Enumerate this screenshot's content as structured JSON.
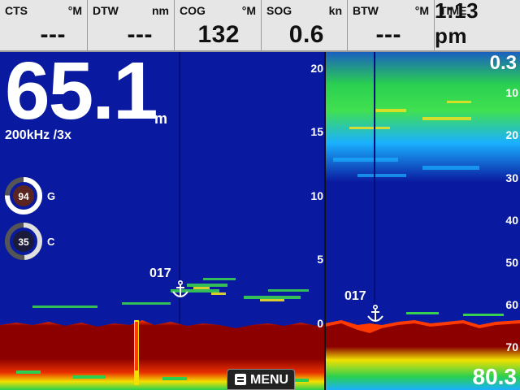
{
  "databar": {
    "fields": [
      {
        "label": "CTS",
        "unit": "°M",
        "value": "---"
      },
      {
        "label": "DTW",
        "unit": "nm",
        "value": "---"
      },
      {
        "label": "COG",
        "unit": "°M",
        "value": "132"
      },
      {
        "label": "SOG",
        "unit": "kn",
        "value": "0.6"
      },
      {
        "label": "BTW",
        "unit": "°M",
        "value": "---"
      },
      {
        "label": "TIME",
        "unit": "",
        "value": "1:13 pm"
      }
    ]
  },
  "left_pane": {
    "depth_value": "65.1",
    "depth_unit": "m",
    "frequency": "200kHz  /3x",
    "gain_gauge": {
      "value": "94",
      "letter": "G",
      "level": 0.94
    },
    "color_gauge": {
      "value": "35",
      "letter": "C",
      "level": 0.35
    },
    "scale": [
      "20",
      "15",
      "10",
      "5",
      "0"
    ],
    "waypoint_label": "017"
  },
  "right_pane": {
    "range_top": "0.3",
    "range_bottom": "80.3",
    "scale": [
      "10",
      "20",
      "30",
      "40",
      "50",
      "60",
      "70"
    ],
    "waypoint_label": "017"
  },
  "menu_button": {
    "label": "MENU"
  },
  "colors": {
    "water": "#0a1aa0",
    "bottom": "#8c0000",
    "strong_echo": "#ff2a00",
    "yellow_echo": "#f4f000",
    "green_echo": "#33d84a",
    "cyan_echo": "#20b0ff"
  }
}
